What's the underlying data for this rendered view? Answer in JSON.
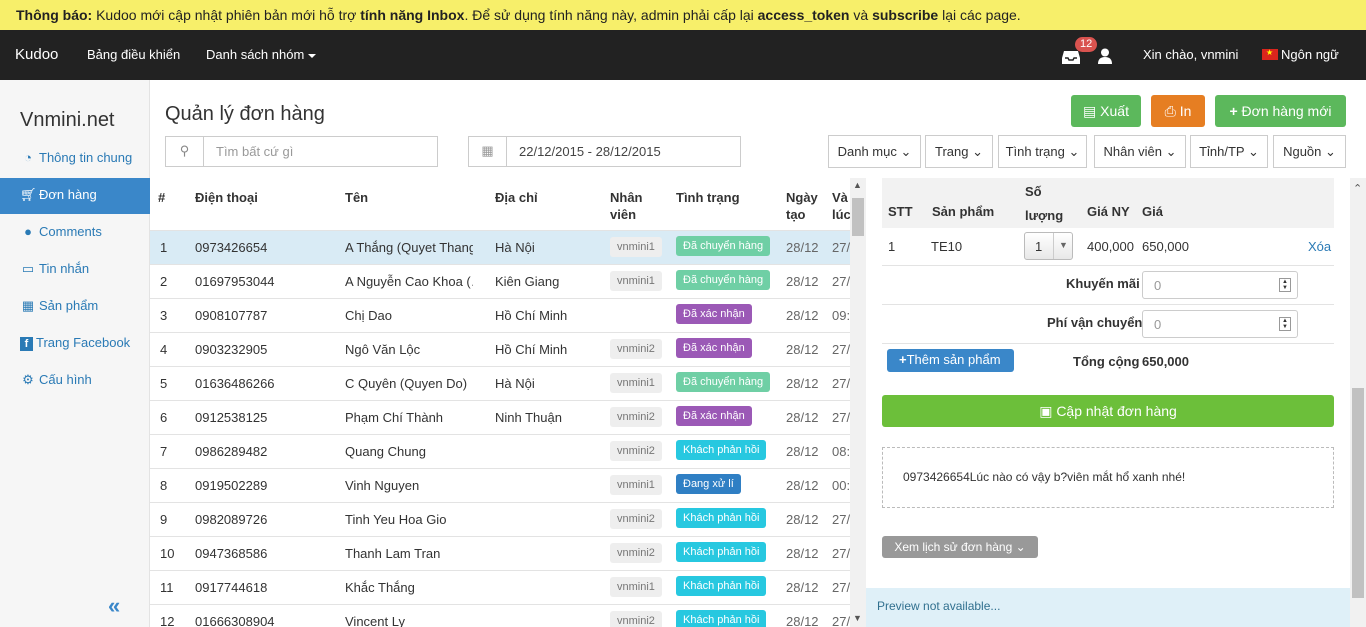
{
  "notice": {
    "label": "Thông báo:",
    "text1": " Kudoo mới cập nhật phiên bản mới hỗ trợ ",
    "bold1": "tính năng Inbox",
    "text2": ". Để sử dụng tính năng này, admin phải cấp lại ",
    "bold2": "access_token",
    "text3": " và ",
    "bold3": "subscribe",
    "text4": " lại các page."
  },
  "topbar": {
    "brand": "Kudoo",
    "nav_dashboard": "Bảng điều khiển",
    "nav_groups": "Danh sách nhóm",
    "inbox_count": "12",
    "greeting": "Xin chào, vnmini",
    "language": "Ngôn ngữ"
  },
  "sidebar": {
    "site": "Vnmini.net",
    "items": [
      {
        "label": "Thông tin chung",
        "icon": "dashboard-icon"
      },
      {
        "label": "Đơn hàng",
        "icon": "cart-icon"
      },
      {
        "label": "Comments",
        "icon": "comments-icon"
      },
      {
        "label": "Tin nhắn",
        "icon": "inbox-icon"
      },
      {
        "label": "Sản phẩm",
        "icon": "gift-icon"
      },
      {
        "label": "Trang Facebook",
        "icon": "facebook-icon"
      },
      {
        "label": "Cấu hình",
        "icon": "gear-icon"
      }
    ],
    "collapse": "«"
  },
  "page": {
    "title": "Quản lý đơn hàng",
    "search_placeholder": "Tìm bất cứ gì",
    "date_range": "22/12/2015 - 28/12/2015",
    "btn_export": "Xuất",
    "btn_print": "In",
    "btn_new": "Đơn hàng mới",
    "filters": [
      "Danh mục",
      "Trang",
      "Tình trạng",
      "Nhân viên",
      "Tỉnh/TP",
      "Nguồn"
    ]
  },
  "table": {
    "headers": {
      "no": "#",
      "phone": "Điện thoại",
      "name": "Tên",
      "address": "Địa chỉ",
      "staff1": "Nhân",
      "staff2": "viên",
      "status": "Tình trạng",
      "date1": "Ngày",
      "date2": "tạo",
      "time1": "Và",
      "time2": "lúc"
    },
    "rows": [
      {
        "no": "1",
        "phone": "0973426654",
        "name": "A Thắng (Quyet Thang)",
        "address": "Hà Nội",
        "staff": "vnmini1",
        "status": "Đã chuyển hàng",
        "date": "28/12",
        "time": "27/"
      },
      {
        "no": "2",
        "phone": "01697953044",
        "name": "A Nguyễn Cao Khoa (…",
        "address": "Kiên Giang",
        "staff": "vnmini1",
        "status": "Đã chuyển hàng",
        "date": "28/12",
        "time": "27/"
      },
      {
        "no": "3",
        "phone": "0908107787",
        "name": "Chị Dao",
        "address": "Hồ Chí Minh",
        "staff": "",
        "status": "Đã xác nhận",
        "date": "28/12",
        "time": "09:"
      },
      {
        "no": "4",
        "phone": "0903232905",
        "name": "Ngô Văn Lộc",
        "address": "Hồ Chí Minh",
        "staff": "vnmini2",
        "status": "Đã xác nhận",
        "date": "28/12",
        "time": "27/"
      },
      {
        "no": "5",
        "phone": "01636486266",
        "name": "C Quyên (Quyen Do)",
        "address": "Hà Nội",
        "staff": "vnmini1",
        "status": "Đã chuyển hàng",
        "date": "28/12",
        "time": "27/"
      },
      {
        "no": "6",
        "phone": "0912538125",
        "name": "Phạm Chí Thành",
        "address": "Ninh Thuận",
        "staff": "vnmini2",
        "status": "Đã xác nhận",
        "date": "28/12",
        "time": "27/"
      },
      {
        "no": "7",
        "phone": "0986289482",
        "name": "Quang Chung",
        "address": "",
        "staff": "vnmini2",
        "status": "Khách phản hồi",
        "date": "28/12",
        "time": "08:"
      },
      {
        "no": "8",
        "phone": "0919502289",
        "name": "Vinh Nguyen",
        "address": "",
        "staff": "vnmini1",
        "status": "Đang xử lí",
        "date": "28/12",
        "time": "00:"
      },
      {
        "no": "9",
        "phone": "0982089726",
        "name": "Tinh Yeu Hoa Gio",
        "address": "",
        "staff": "vnmini2",
        "status": "Khách phản hồi",
        "date": "28/12",
        "time": "27/"
      },
      {
        "no": "10",
        "phone": "0947368586",
        "name": "Thanh Lam Tran",
        "address": "",
        "staff": "vnmini2",
        "status": "Khách phản hồi",
        "date": "28/12",
        "time": "27/"
      },
      {
        "no": "11",
        "phone": "0917744618",
        "name": "Khắc Thắng",
        "address": "",
        "staff": "vnmini1",
        "status": "Khách phản hồi",
        "date": "28/12",
        "time": "27/"
      },
      {
        "no": "12",
        "phone": "01666308904",
        "name": "Vincent Ly",
        "address": "",
        "staff": "vnmini2",
        "status": "Khách phản hồi",
        "date": "28/12",
        "time": "27/"
      }
    ],
    "status_colors": {
      "Đã chuyển hàng": "#6fcfa5",
      "Đã xác nhận": "#9b59b6",
      "Khách phản hồi": "#27c8e0",
      "Đang xử lí": "#2f7fc4"
    }
  },
  "detail": {
    "headers": {
      "stt": "STT",
      "product": "Sản phẩm",
      "qty1": "Số",
      "qty2": "lượng",
      "list_price": "Giá NY",
      "price": "Giá"
    },
    "item": {
      "stt": "1",
      "product": "TE10",
      "qty": "1",
      "list_price": "400,000",
      "price": "650,000",
      "delete": "Xóa"
    },
    "discount_label": "Khuyến mãi",
    "discount_value": "0",
    "shipping_label": "Phí vận chuyển",
    "shipping_value": "0",
    "add_product": "Thêm sản phẩm",
    "total_label": "Tổng cộng",
    "total_value": "650,000",
    "update_button": "Cập nhật đơn hàng",
    "note": "0973426654Lúc nào có vậy b?viên mắt hổ xanh nhé!",
    "history_button": "Xem lịch sử đơn hàng",
    "preview": "Preview not available..."
  }
}
